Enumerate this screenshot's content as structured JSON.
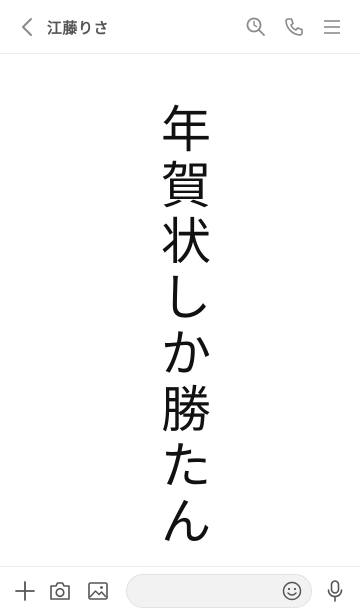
{
  "header": {
    "title": "江藤りさ",
    "icons": [
      "back-icon",
      "search-icon",
      "phone-icon",
      "menu-icon"
    ]
  },
  "content": {
    "vertical_text": [
      "年",
      "賀",
      "状",
      "し",
      "か",
      "勝",
      "た",
      "ん"
    ]
  },
  "footer": {
    "icons": [
      "plus-icon",
      "camera-icon",
      "image-icon",
      "emoji-icon",
      "microphone-icon"
    ],
    "message_placeholder": ""
  },
  "colors": {
    "icon": "#8a8a8a",
    "text": "#111111",
    "title": "#555555"
  }
}
